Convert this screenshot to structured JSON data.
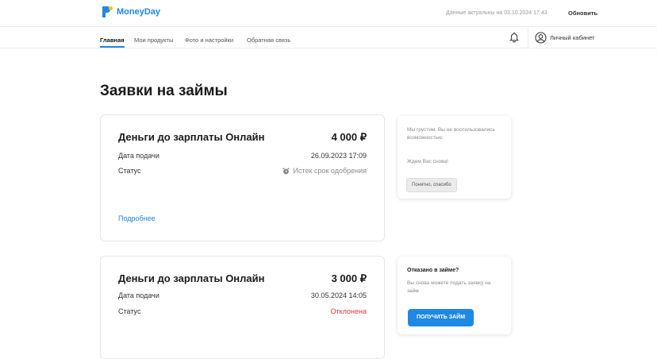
{
  "header": {
    "logo_text": "MoneyDay",
    "updated_text": "Данные актуальны на 03.10.2024 17:43",
    "refresh_label": "Обновить"
  },
  "nav": {
    "items": [
      {
        "label": "Главная",
        "active": true
      },
      {
        "label": "Мои продукты",
        "active": false
      },
      {
        "label": "Фото и настройки",
        "active": false
      },
      {
        "label": "Обратная связь",
        "active": false
      }
    ],
    "account_label": "Личный кабинет"
  },
  "page": {
    "title": "Заявки на займы"
  },
  "loans": [
    {
      "name": "Деньги до зарплаты Онлайн",
      "amount": "4 000 ₽",
      "date_label": "Дата подачи",
      "date_value": "26.09.2023 17:09",
      "status_label": "Статус",
      "status_value": "Истек срок одобрения",
      "status_icon": "alarm-clock-icon",
      "more_label": "Подробнее"
    },
    {
      "name": "Деньги до зарплаты Онлайн",
      "amount": "3 000 ₽",
      "date_label": "Дата подачи",
      "date_value": "30.05.2024 14:05",
      "status_label": "Статус",
      "status_value": "Отклонена",
      "status_color": "#e53935"
    }
  ],
  "side_panels": [
    {
      "text": "Мы грустим, Вы не воспользовались возможностью.",
      "text2": "Ждем Вас снова!",
      "button_label": "Понятно, спасибо"
    },
    {
      "title": "Отказано в займе?",
      "text": "Вы снова можете подать заявку на займ",
      "button_label": "ПОЛУЧИТЬ ЗАЙМ"
    }
  ],
  "colors": {
    "accent": "#1e88e5",
    "error": "#e53935"
  }
}
